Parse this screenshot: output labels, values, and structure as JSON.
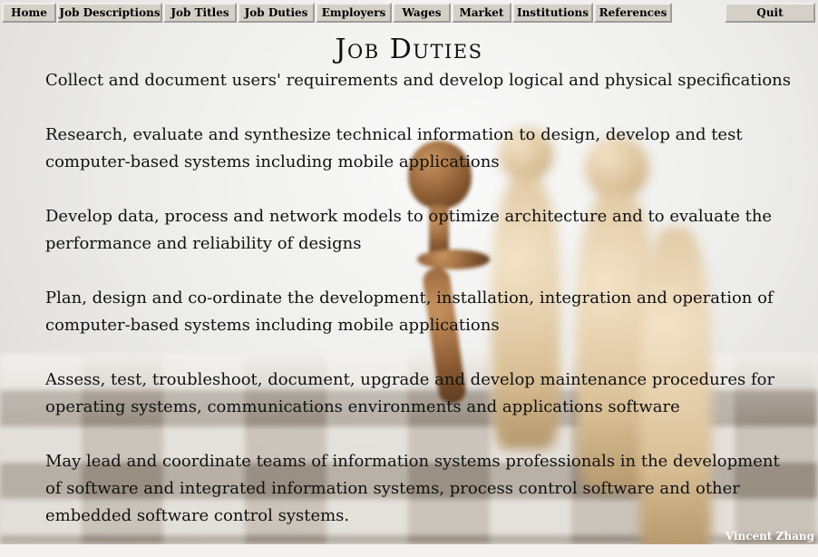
{
  "menu": {
    "items": [
      {
        "label": "Home"
      },
      {
        "label": "Job Descriptions"
      },
      {
        "label": "Job Titles"
      },
      {
        "label": "Job Duties"
      },
      {
        "label": "Employers"
      },
      {
        "label": "Wages"
      },
      {
        "label": "Market"
      },
      {
        "label": "Institutions"
      },
      {
        "label": "References"
      }
    ],
    "quit_label": "Quit"
  },
  "page": {
    "title": "Job Duties",
    "duties": [
      "Collect and document users' requirements and develop logical and physical specifications",
      "Research, evaluate and synthesize technical information to design, develop and test computer-based systems including mobile applications",
      "Develop data, process and network models to optimize architecture and to evaluate the performance and reliability of designs",
      "Plan, design and co-ordinate the development, installation, integration and operation of computer-based systems including mobile applications",
      "Assess, test, troubleshoot, document, upgrade and develop maintenance procedures for operating systems, communications environments and applications software",
      "May lead and coordinate teams of information systems professionals in the development of software and integrated information systems, process control software and other embedded software control systems."
    ]
  },
  "credit": "Vincent Zhang",
  "colors": {
    "button_face": "#d4d0c8",
    "text": "#111111",
    "credit_text": "#ffffff"
  }
}
